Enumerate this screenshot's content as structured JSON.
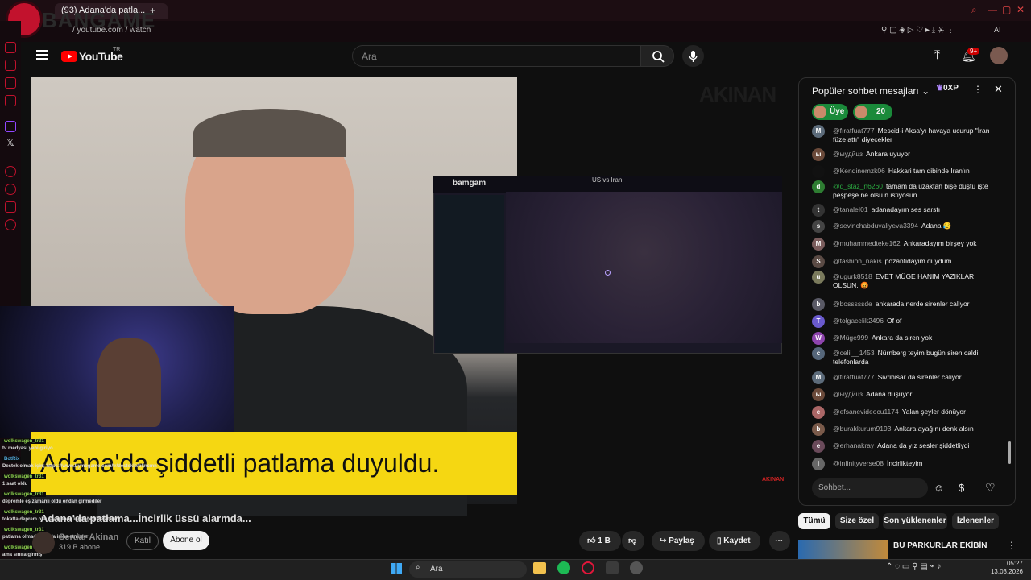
{
  "browser": {
    "tab_title": "(93) Adana'da patla...",
    "address": "/ youtube.com / watch",
    "brand_overlay": "BANGAME"
  },
  "youtube": {
    "wordmark": "YouTube",
    "region": "TR",
    "search_placeholder": "Ara",
    "notif_count": "9+"
  },
  "video": {
    "subtitle": "Adana'da şiddetli patlama duyuldu.",
    "watermark": "AKINAN",
    "watermark_small": "AKINAN",
    "map_brand": "bamgam",
    "map_title": "US vs Iran"
  },
  "stream_chat": [
    {
      "name": "wolkswagen_tr31",
      "msg": "tv medyası yeni giriyo"
    },
    {
      "name": "BotRix",
      "msg": "Destek olmak için; https://www.bymogame.com/tr/destekle/bkncmn"
    },
    {
      "name": "wolkswagen_tr31",
      "msg": "1 saat oldu"
    },
    {
      "name": "wolkswagen_tr31",
      "msg": "depremle eş zamanlı oldu ondan girmediler"
    },
    {
      "name": "wolkswagen_tr31",
      "msg": "tokatta deprem oldu aynı anda incirliğe füze attılar"
    },
    {
      "name": "wolkswagen_tr31",
      "msg": "patlama olmadı havada imha etmişler"
    },
    {
      "name": "wolkswagen_tr31",
      "msg": "ama sınıra girmiş"
    },
    {
      "name": "wolkswagen_tr31",
      "msg": ""
    }
  ],
  "meta": {
    "title": "Adana'da patlama...İncirlik üssü alarmda...",
    "channel": "Serdar Akinan",
    "subscribers": "319 B abone",
    "join": "Katıl",
    "subscribe": "Abone ol",
    "likes": "1 B",
    "share": "Paylaş",
    "save": "Kaydet"
  },
  "chat": {
    "title": "Popüler sohbet mesajları",
    "xp": "0XP",
    "member_label": "Üye",
    "count": "20",
    "input_placeholder": "Sohbet...",
    "messages": [
      {
        "author": "@fıratfuat777",
        "text": "Mescid-i Aksa'yı havaya ucurup \"İran füze attı\" diyecekler",
        "initial": "M",
        "color": "#5c6b7a",
        "member": false
      },
      {
        "author": "@ыудйцз",
        "text": "Ankara uyuyor",
        "initial": "ы",
        "color": "#6b4a3a",
        "member": false
      },
      {
        "author": "@Kendinemzk06",
        "text": "Hakkari tam dibinde İran'ın",
        "initial": "",
        "color": "#111111",
        "member": false
      },
      {
        "author": "@d_staz_n6260",
        "text": "tamam da uzaktan bişe düştü işte peşpeşe ne olsu n istiyosun",
        "initial": "d",
        "color": "#2e7d32",
        "member": true
      },
      {
        "author": "@tanaleI01",
        "text": "adanadayım ses sarstı",
        "initial": "t",
        "color": "#333333",
        "member": false
      },
      {
        "author": "@sevinchabduvaliyeva3394",
        "text": "Adana 😥",
        "initial": "s",
        "color": "#444444",
        "member": false
      },
      {
        "author": "@muhammedteke162",
        "text": "Ankaradayım birşey yok",
        "initial": "M",
        "color": "#7a5c5c",
        "member": false
      },
      {
        "author": "@fashion_nakis",
        "text": "pozantidayim duydum",
        "initial": "S",
        "color": "#5a4a44",
        "member": false
      },
      {
        "author": "@ugurk8518",
        "text": "EVET MÜGE HANIM YAZIKLAR OLSUN. 😡",
        "initial": "u",
        "color": "#7a7a5c",
        "member": false
      },
      {
        "author": "@bosssssde",
        "text": "ankarada nerde sirenler caliyor",
        "initial": "b",
        "color": "#5a5a66",
        "member": false
      },
      {
        "author": "@tolgacelik2496",
        "text": "Of of",
        "initial": "T",
        "color": "#6a5acd",
        "member": false
      },
      {
        "author": "@Müge999",
        "text": "Ankara da siren yok",
        "initial": "W",
        "color": "#8e44ad",
        "member": false
      },
      {
        "author": "@celil__1453",
        "text": "Nürnberg teyim bugün siren caldi telefonlarda",
        "initial": "c",
        "color": "#55667a",
        "member": false
      },
      {
        "author": "@fıratfuat777",
        "text": "Sivrihisar da sirenler caliyor",
        "initial": "M",
        "color": "#5c6b7a",
        "member": false
      },
      {
        "author": "@ыудйцз",
        "text": "Adana düşüyor",
        "initial": "ы",
        "color": "#6b4a3a",
        "member": false
      },
      {
        "author": "@efsanevideocu1174",
        "text": "Yalan şeyler dönüyor",
        "initial": "e",
        "color": "#aa6666",
        "member": false
      },
      {
        "author": "@burakkurum9193",
        "text": "Ankara ayağını denk alsın",
        "initial": "b",
        "color": "#7a5a4a",
        "member": false
      },
      {
        "author": "@erhanakray",
        "text": "Adana da yız sesler şiddetliydi",
        "initial": "e",
        "color": "#6a4a5a",
        "member": false
      },
      {
        "author": "@infinityverse08",
        "text": "İncirlikteyim",
        "initial": "i",
        "color": "#666666",
        "member": false
      }
    ]
  },
  "chips": [
    "Tümü",
    "Size özel",
    "Son yüklenenler",
    "İzlenenler"
  ],
  "recommendation": {
    "title": "BU PARKURLAR EKİBİN"
  },
  "taskbar": {
    "search": "Ara",
    "time": "05:27",
    "date": "13.03.2026"
  }
}
